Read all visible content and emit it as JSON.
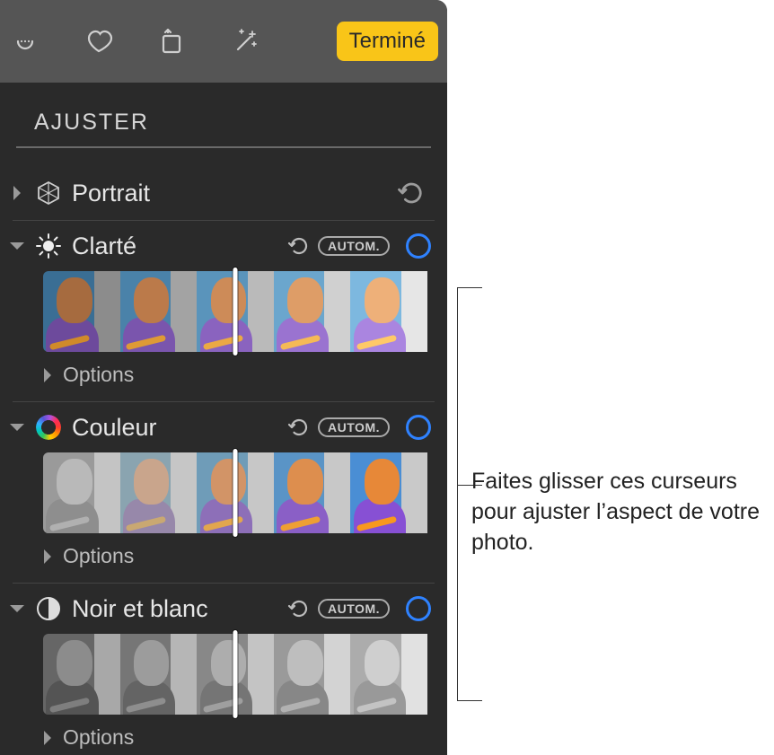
{
  "toolbar": {
    "done_label": "Terminé"
  },
  "panel": {
    "title": "AJUSTER",
    "portrait": {
      "label": "Portrait"
    },
    "light": {
      "label": "Clarté",
      "auto_label": "AUTOM.",
      "options_label": "Options"
    },
    "color": {
      "label": "Couleur",
      "auto_label": "AUTOM.",
      "options_label": "Options"
    },
    "bw": {
      "label": "Noir et blanc",
      "auto_label": "AUTOM.",
      "options_label": "Options"
    }
  },
  "callout": {
    "text": "Faites glisser ces curseurs pour ajuster l’aspect de votre photo."
  },
  "thumb_palettes": {
    "light": [
      {
        "bg": "#3a6e94",
        "wall": "#8c8c8c",
        "skin": "#a66b3f",
        "shirt": "#6d4a9c",
        "stripe": "#d08a2a"
      },
      {
        "bg": "#4a82a9",
        "wall": "#a3a3a3",
        "skin": "#bb7a4a",
        "shirt": "#7a55ad",
        "stripe": "#de9a36"
      },
      {
        "bg": "#5a94bb",
        "wall": "#bababa",
        "skin": "#cd8b58",
        "shirt": "#8a63bf",
        "stripe": "#eba944"
      },
      {
        "bg": "#6ba6cd",
        "wall": "#d0d0d0",
        "skin": "#de9d67",
        "shirt": "#9a73d0",
        "stripe": "#f5b956"
      },
      {
        "bg": "#7db8df",
        "wall": "#e6e6e6",
        "skin": "#eeb079",
        "shirt": "#aa85e0",
        "stripe": "#ffc968"
      }
    ],
    "color": [
      {
        "bg": "#9a9a9a",
        "wall": "#c4c4c4",
        "skin": "#b9b9b9",
        "shirt": "#8e8e8e",
        "stripe": "#b0b0b0"
      },
      {
        "bg": "#8aa4b0",
        "wall": "#c6c6c6",
        "skin": "#c9a58c",
        "shirt": "#9788aa",
        "stripe": "#c9a872"
      },
      {
        "bg": "#6f9cb8",
        "wall": "#c7c7c7",
        "skin": "#d29467",
        "shirt": "#8d6fb8",
        "stripe": "#e2a64e"
      },
      {
        "bg": "#5a94c6",
        "wall": "#c8c8c8",
        "skin": "#dd8e4e",
        "shirt": "#8a5fc6",
        "stripe": "#ee9f34"
      },
      {
        "bg": "#4a8ed4",
        "wall": "#c9c9c9",
        "skin": "#e78838",
        "shirt": "#8750d4",
        "stripe": "#f8981e"
      }
    ],
    "bw": [
      {
        "bg": "#666666",
        "wall": "#a8a8a8",
        "skin": "#8c8c8c",
        "shirt": "#545454",
        "stripe": "#7e7e7e"
      },
      {
        "bg": "#767676",
        "wall": "#b6b6b6",
        "skin": "#9c9c9c",
        "shirt": "#646464",
        "stripe": "#8e8e8e"
      },
      {
        "bg": "#888888",
        "wall": "#c4c4c4",
        "skin": "#adadad",
        "shirt": "#757575",
        "stripe": "#9f9f9f"
      },
      {
        "bg": "#9a9a9a",
        "wall": "#d3d3d3",
        "skin": "#bebebe",
        "shirt": "#878787",
        "stripe": "#b1b1b1"
      },
      {
        "bg": "#acacac",
        "wall": "#e1e1e1",
        "skin": "#cfcfcf",
        "shirt": "#999999",
        "stripe": "#c3c3c3"
      }
    ]
  }
}
